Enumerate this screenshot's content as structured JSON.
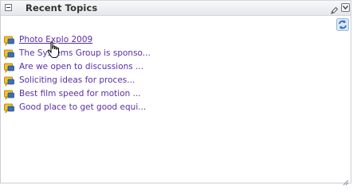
{
  "portlet": {
    "title": "Recent Topics"
  },
  "icons": {
    "collapse": "collapse-icon",
    "edit": "pencil-icon",
    "menu": "chevron-down-icon",
    "refresh": "refresh-icon",
    "topic": "discussion-topic-icon",
    "resize": "resize-grip-icon"
  },
  "colors": {
    "link": "#5a2ea6",
    "header_bg": "#e4e7eb",
    "topic_icon_yellow": "#f2c230",
    "topic_icon_blue": "#3b6fb6"
  },
  "topics": [
    {
      "label": "Photo Explo 2009"
    },
    {
      "label": "The Systems Group is sponso..."
    },
    {
      "label": "Are we open to discussions ..."
    },
    {
      "label": "Soliciting ideas for proces..."
    },
    {
      "label": "Best film speed for motion ..."
    },
    {
      "label": "Good place to get good equi..."
    }
  ]
}
